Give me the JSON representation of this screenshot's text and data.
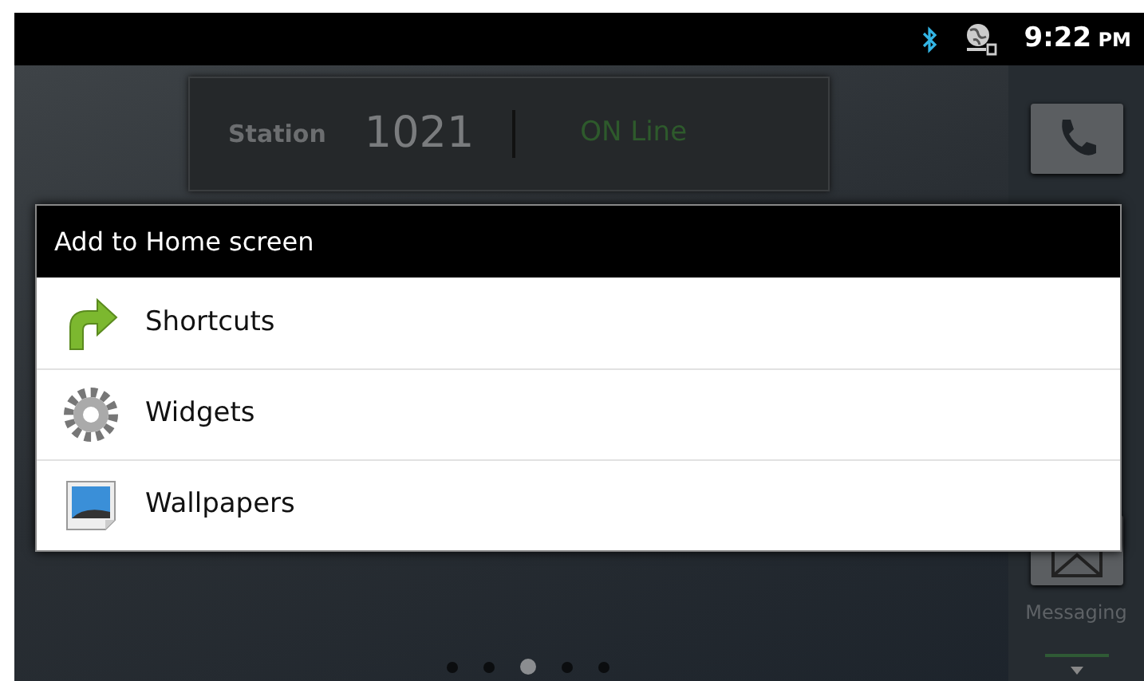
{
  "status_bar": {
    "time": "9:22",
    "time_suffix": "PM"
  },
  "station_widget": {
    "label": "Station",
    "number": "1021",
    "status": "ON Line"
  },
  "dock": [
    {
      "kind": "call"
    },
    {
      "kind": "hidden"
    },
    {
      "kind": "messaging",
      "label": "Messaging"
    }
  ],
  "pages": [
    {
      "selected": false
    },
    {
      "selected": false
    },
    {
      "selected": true
    },
    {
      "selected": false
    },
    {
      "selected": false
    }
  ],
  "dialog": {
    "title": "Add to Home screen",
    "items": [
      {
        "kind": "shortcuts",
        "label": "Shortcuts"
      },
      {
        "kind": "widgets",
        "label": "Widgets"
      },
      {
        "kind": "wallpapers",
        "label": "Wallpapers"
      }
    ]
  }
}
